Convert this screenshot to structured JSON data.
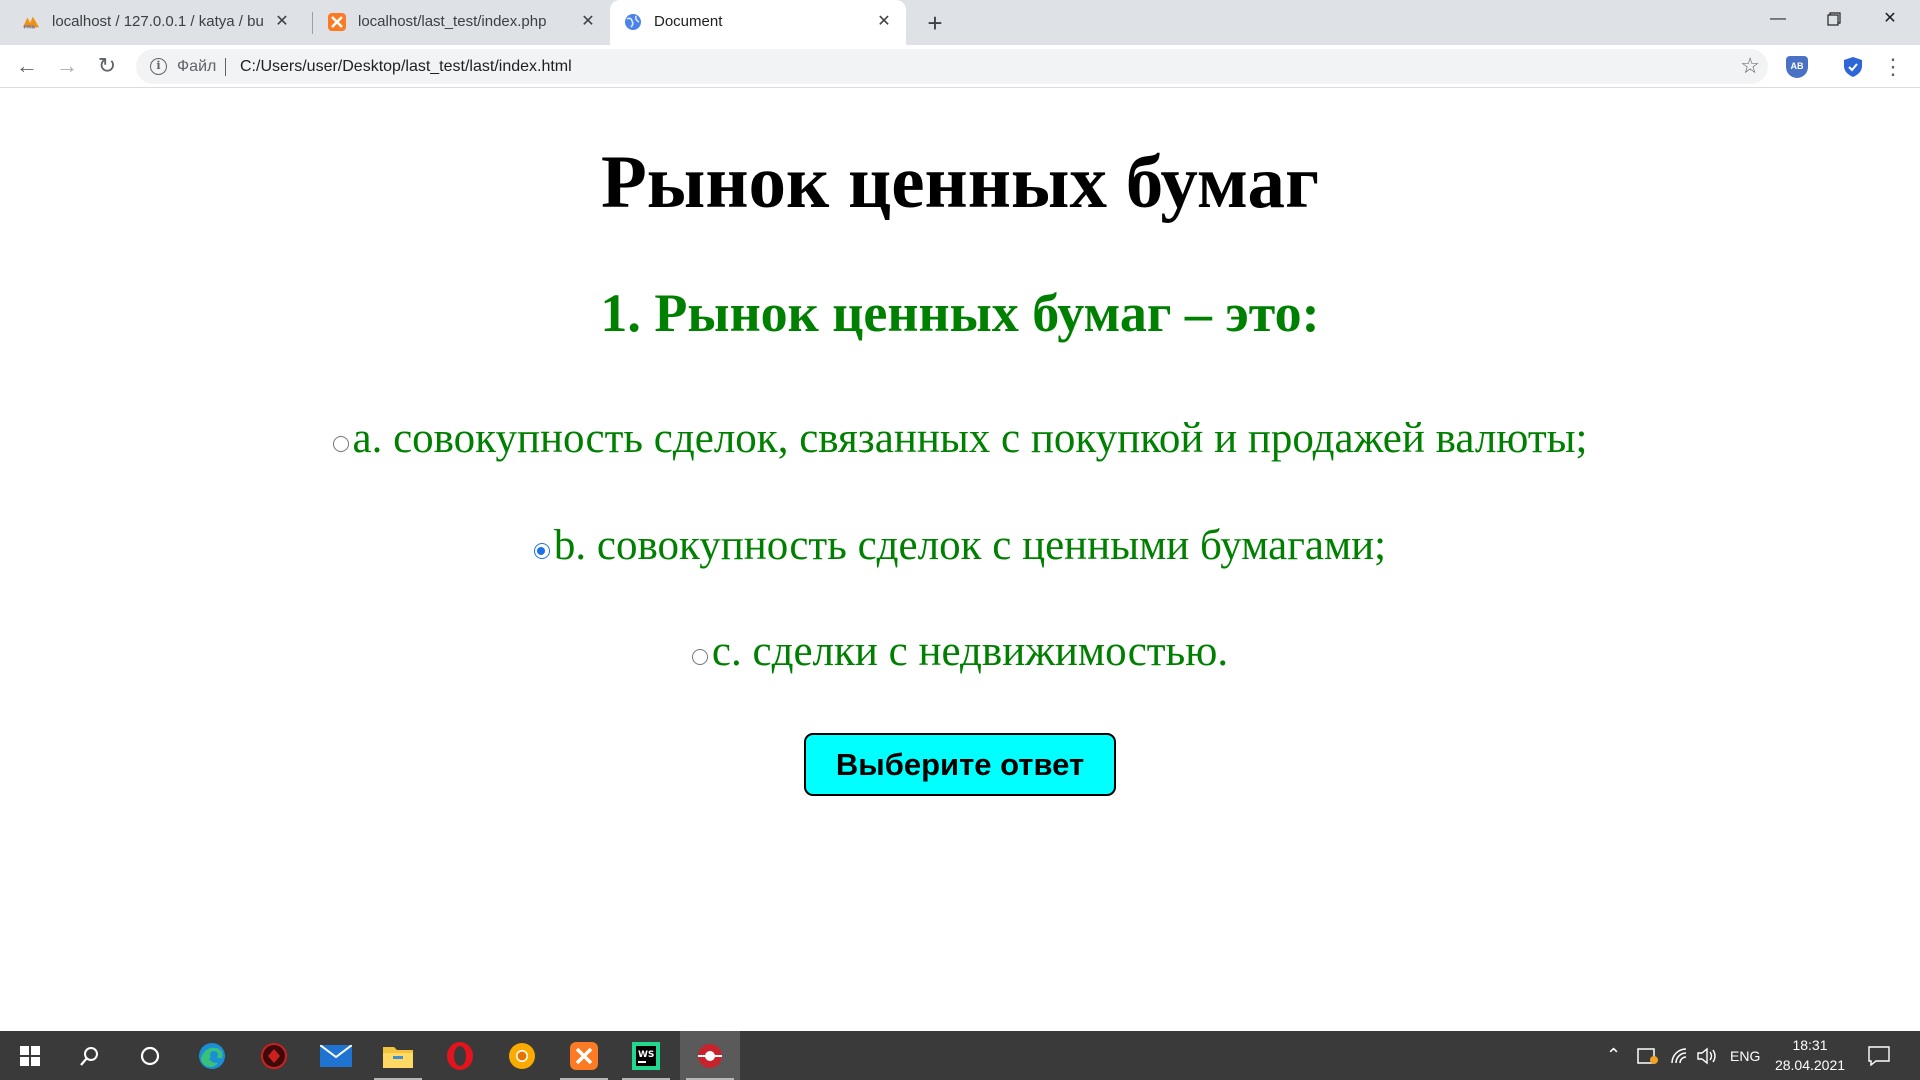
{
  "browser": {
    "tabs": [
      {
        "title": "localhost / 127.0.0.1 / katya / bu",
        "icon": "phpmyadmin-icon",
        "active": false
      },
      {
        "title": "localhost/last_test/index.php",
        "icon": "xampp-icon",
        "active": false
      },
      {
        "title": "Document",
        "icon": "globe-icon",
        "active": true
      }
    ],
    "address": {
      "scheme_label": "Файл",
      "url": "C:/Users/user/Desktop/last_test/last/index.html"
    },
    "extensions": {
      "adblock_label": "AB"
    }
  },
  "page": {
    "title": "Рынок ценных бумаг",
    "question": "1. Рынок ценных бумаг – это:",
    "options": [
      {
        "label": "a. совокупность сделок, связанных с покупкой и продажей валюты;",
        "checked": false
      },
      {
        "label": "b. совокупность сделок с ценными бумагами;",
        "checked": true
      },
      {
        "label": "c. сделки с недвижимостью.",
        "checked": false
      }
    ],
    "submit_label": "Выберите ответ",
    "colors": {
      "text_green": "#008000",
      "button_bg": "#00ffff"
    }
  },
  "taskbar": {
    "apps": [
      "windows-start-icon",
      "search-icon",
      "cortana-icon",
      "edge-icon",
      "game-icon",
      "mail-icon",
      "file-explorer-icon",
      "opera-icon",
      "chrome-canary-icon",
      "xampp-icon",
      "webstorm-icon",
      "browser-icon"
    ],
    "tray": {
      "language": "ENG",
      "time": "18:31",
      "date": "28.04.2021"
    }
  }
}
